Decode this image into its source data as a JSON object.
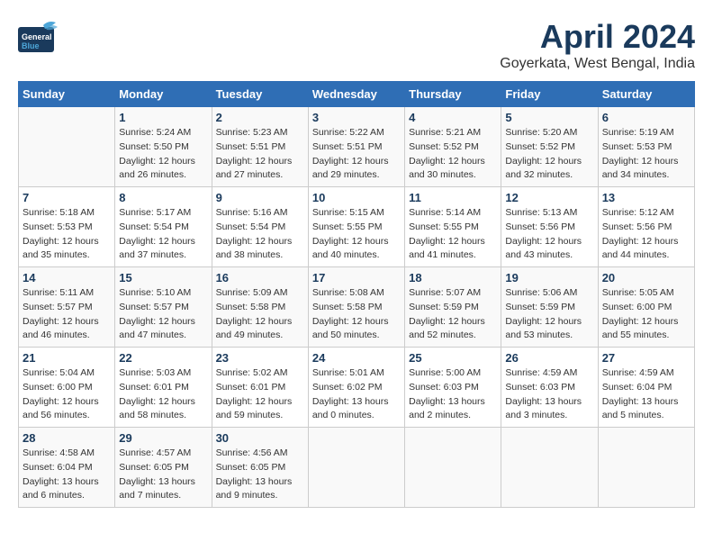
{
  "header": {
    "logo_general": "General",
    "logo_blue": "Blue",
    "month": "April 2024",
    "location": "Goyerkata, West Bengal, India"
  },
  "days_of_week": [
    "Sunday",
    "Monday",
    "Tuesday",
    "Wednesday",
    "Thursday",
    "Friday",
    "Saturday"
  ],
  "weeks": [
    [
      {
        "day": "",
        "info": ""
      },
      {
        "day": "1",
        "info": "Sunrise: 5:24 AM\nSunset: 5:50 PM\nDaylight: 12 hours\nand 26 minutes."
      },
      {
        "day": "2",
        "info": "Sunrise: 5:23 AM\nSunset: 5:51 PM\nDaylight: 12 hours\nand 27 minutes."
      },
      {
        "day": "3",
        "info": "Sunrise: 5:22 AM\nSunset: 5:51 PM\nDaylight: 12 hours\nand 29 minutes."
      },
      {
        "day": "4",
        "info": "Sunrise: 5:21 AM\nSunset: 5:52 PM\nDaylight: 12 hours\nand 30 minutes."
      },
      {
        "day": "5",
        "info": "Sunrise: 5:20 AM\nSunset: 5:52 PM\nDaylight: 12 hours\nand 32 minutes."
      },
      {
        "day": "6",
        "info": "Sunrise: 5:19 AM\nSunset: 5:53 PM\nDaylight: 12 hours\nand 34 minutes."
      }
    ],
    [
      {
        "day": "7",
        "info": "Sunrise: 5:18 AM\nSunset: 5:53 PM\nDaylight: 12 hours\nand 35 minutes."
      },
      {
        "day": "8",
        "info": "Sunrise: 5:17 AM\nSunset: 5:54 PM\nDaylight: 12 hours\nand 37 minutes."
      },
      {
        "day": "9",
        "info": "Sunrise: 5:16 AM\nSunset: 5:54 PM\nDaylight: 12 hours\nand 38 minutes."
      },
      {
        "day": "10",
        "info": "Sunrise: 5:15 AM\nSunset: 5:55 PM\nDaylight: 12 hours\nand 40 minutes."
      },
      {
        "day": "11",
        "info": "Sunrise: 5:14 AM\nSunset: 5:55 PM\nDaylight: 12 hours\nand 41 minutes."
      },
      {
        "day": "12",
        "info": "Sunrise: 5:13 AM\nSunset: 5:56 PM\nDaylight: 12 hours\nand 43 minutes."
      },
      {
        "day": "13",
        "info": "Sunrise: 5:12 AM\nSunset: 5:56 PM\nDaylight: 12 hours\nand 44 minutes."
      }
    ],
    [
      {
        "day": "14",
        "info": "Sunrise: 5:11 AM\nSunset: 5:57 PM\nDaylight: 12 hours\nand 46 minutes."
      },
      {
        "day": "15",
        "info": "Sunrise: 5:10 AM\nSunset: 5:57 PM\nDaylight: 12 hours\nand 47 minutes."
      },
      {
        "day": "16",
        "info": "Sunrise: 5:09 AM\nSunset: 5:58 PM\nDaylight: 12 hours\nand 49 minutes."
      },
      {
        "day": "17",
        "info": "Sunrise: 5:08 AM\nSunset: 5:58 PM\nDaylight: 12 hours\nand 50 minutes."
      },
      {
        "day": "18",
        "info": "Sunrise: 5:07 AM\nSunset: 5:59 PM\nDaylight: 12 hours\nand 52 minutes."
      },
      {
        "day": "19",
        "info": "Sunrise: 5:06 AM\nSunset: 5:59 PM\nDaylight: 12 hours\nand 53 minutes."
      },
      {
        "day": "20",
        "info": "Sunrise: 5:05 AM\nSunset: 6:00 PM\nDaylight: 12 hours\nand 55 minutes."
      }
    ],
    [
      {
        "day": "21",
        "info": "Sunrise: 5:04 AM\nSunset: 6:00 PM\nDaylight: 12 hours\nand 56 minutes."
      },
      {
        "day": "22",
        "info": "Sunrise: 5:03 AM\nSunset: 6:01 PM\nDaylight: 12 hours\nand 58 minutes."
      },
      {
        "day": "23",
        "info": "Sunrise: 5:02 AM\nSunset: 6:01 PM\nDaylight: 12 hours\nand 59 minutes."
      },
      {
        "day": "24",
        "info": "Sunrise: 5:01 AM\nSunset: 6:02 PM\nDaylight: 13 hours\nand 0 minutes."
      },
      {
        "day": "25",
        "info": "Sunrise: 5:00 AM\nSunset: 6:03 PM\nDaylight: 13 hours\nand 2 minutes."
      },
      {
        "day": "26",
        "info": "Sunrise: 4:59 AM\nSunset: 6:03 PM\nDaylight: 13 hours\nand 3 minutes."
      },
      {
        "day": "27",
        "info": "Sunrise: 4:59 AM\nSunset: 6:04 PM\nDaylight: 13 hours\nand 5 minutes."
      }
    ],
    [
      {
        "day": "28",
        "info": "Sunrise: 4:58 AM\nSunset: 6:04 PM\nDaylight: 13 hours\nand 6 minutes."
      },
      {
        "day": "29",
        "info": "Sunrise: 4:57 AM\nSunset: 6:05 PM\nDaylight: 13 hours\nand 7 minutes."
      },
      {
        "day": "30",
        "info": "Sunrise: 4:56 AM\nSunset: 6:05 PM\nDaylight: 13 hours\nand 9 minutes."
      },
      {
        "day": "",
        "info": ""
      },
      {
        "day": "",
        "info": ""
      },
      {
        "day": "",
        "info": ""
      },
      {
        "day": "",
        "info": ""
      }
    ]
  ]
}
